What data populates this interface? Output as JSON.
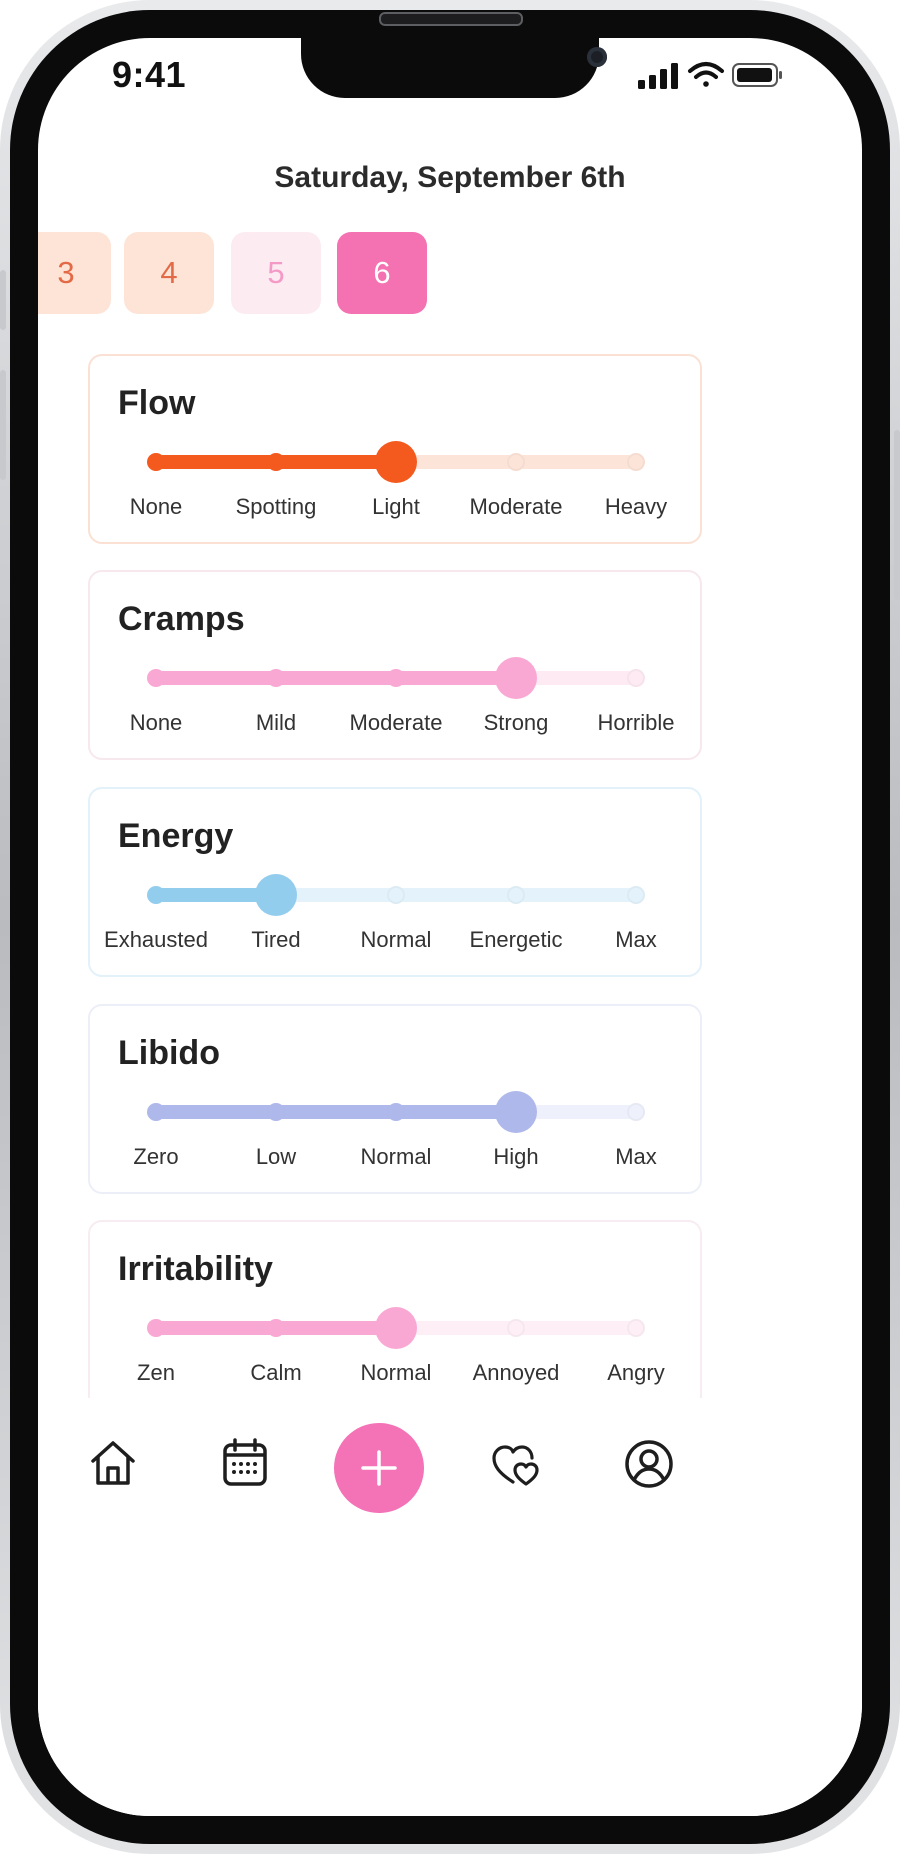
{
  "status_bar": {
    "time": "9:41"
  },
  "header": {
    "date": "Saturday, September 6th"
  },
  "day_picker": [
    {
      "label": "3",
      "state": "past"
    },
    {
      "label": "4",
      "state": "past"
    },
    {
      "label": "5",
      "state": "future"
    },
    {
      "label": "6",
      "state": "selected"
    }
  ],
  "trackers": [
    {
      "title": "Flow",
      "options": [
        "None",
        "Spotting",
        "Light",
        "Moderate",
        "Heavy"
      ],
      "selected_index": 2,
      "color": "#f4591e",
      "track_color": "#fde4d8",
      "border_color": "#fbe1d4"
    },
    {
      "title": "Cramps",
      "options": [
        "None",
        "Mild",
        "Moderate",
        "Strong",
        "Horrible"
      ],
      "selected_index": 3,
      "color": "#f9a8d4",
      "track_color": "#fdeaf3",
      "border_color": "#f7e8ee"
    },
    {
      "title": "Energy",
      "options": [
        "Exhausted",
        "Tired",
        "Normal",
        "Energetic",
        "Max"
      ],
      "selected_index": 1,
      "color": "#93cdee",
      "track_color": "#e4f3fb",
      "border_color": "#e2f1fa"
    },
    {
      "title": "Libido",
      "options": [
        "Zero",
        "Low",
        "Normal",
        "High",
        "Max"
      ],
      "selected_index": 3,
      "color": "#aeb8ea",
      "track_color": "#eef0fb",
      "border_color": "#eceff7"
    },
    {
      "title": "Irritability",
      "options": [
        "Zen",
        "Calm",
        "Normal",
        "Annoyed",
        "Angry"
      ],
      "selected_index": 2,
      "color": "#f9a8d4",
      "track_color": "#fdeff5",
      "border_color": "#f7ecf1"
    }
  ],
  "nav": {
    "items": [
      "home-icon",
      "calendar-icon",
      "plus-icon",
      "hearts-icon",
      "profile-icon"
    ],
    "accent": "#f472b6"
  }
}
